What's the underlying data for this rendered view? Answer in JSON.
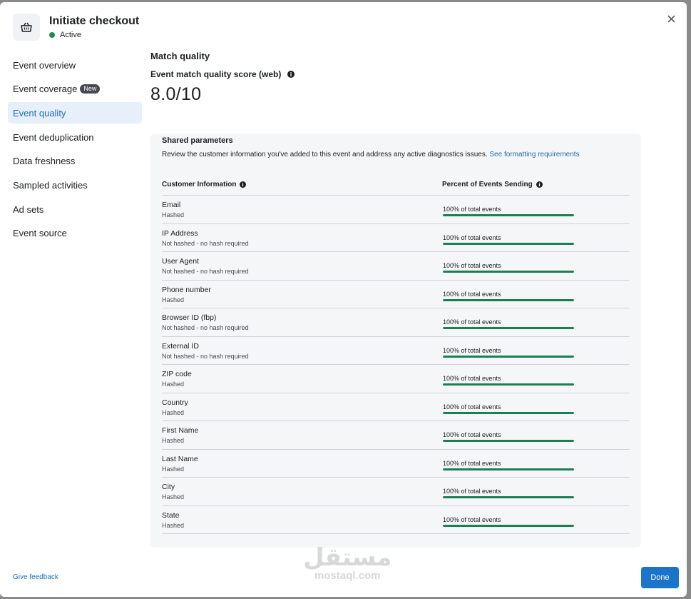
{
  "header": {
    "title": "Initiate checkout",
    "status": "Active",
    "status_color": "#1e8a4c"
  },
  "nav": {
    "items": [
      {
        "label": "Event overview"
      },
      {
        "label": "Event coverage",
        "badge": "New"
      },
      {
        "label": "Event quality"
      },
      {
        "label": "Event deduplication"
      },
      {
        "label": "Data freshness"
      },
      {
        "label": "Sampled activities"
      },
      {
        "label": "Ad sets"
      },
      {
        "label": "Event source"
      }
    ],
    "active_index": 2
  },
  "main": {
    "section_title": "Match quality",
    "score_label": "Event match quality score (web)",
    "score": "8.0/10"
  },
  "panel": {
    "title": "Shared parameters",
    "description": "Review the customer information you've added to this event and address any active diagnostics issues.",
    "link_text": "See formatting requirements",
    "col_left": "Customer Information",
    "col_right": "Percent of Events Sending",
    "rows": [
      {
        "name": "Email",
        "sub": "Hashed",
        "pct_text": "100% of total events",
        "pct": 100
      },
      {
        "name": "IP Address",
        "sub": "Not hashed - no hash required",
        "pct_text": "100% of total events",
        "pct": 100
      },
      {
        "name": "User Agent",
        "sub": "Not hashed - no hash required",
        "pct_text": "100% of total events",
        "pct": 100
      },
      {
        "name": "Phone number",
        "sub": "Hashed",
        "pct_text": "100% of total events",
        "pct": 100
      },
      {
        "name": "Browser ID (fbp)",
        "sub": "Not hashed - no hash required",
        "pct_text": "100% of total events",
        "pct": 100
      },
      {
        "name": "External ID",
        "sub": "Not hashed - no hash required",
        "pct_text": "100% of total events",
        "pct": 100
      },
      {
        "name": "ZIP code",
        "sub": "Hashed",
        "pct_text": "100% of total events",
        "pct": 100
      },
      {
        "name": "Country",
        "sub": "Hashed",
        "pct_text": "100% of total events",
        "pct": 100
      },
      {
        "name": "First Name",
        "sub": "Hashed",
        "pct_text": "100% of total events",
        "pct": 100
      },
      {
        "name": "Last Name",
        "sub": "Hashed",
        "pct_text": "100% of total events",
        "pct": 100
      },
      {
        "name": "City",
        "sub": "Hashed",
        "pct_text": "100% of total events",
        "pct": 100
      },
      {
        "name": "State",
        "sub": "Hashed",
        "pct_text": "100% of total events",
        "pct": 100
      }
    ]
  },
  "footer": {
    "feedback": "Give feedback",
    "done": "Done"
  },
  "watermark": {
    "arabic": "مستقل",
    "latin": "mostaql.com"
  },
  "colors": {
    "accent": "#1b74c9",
    "progress": "#1a7f52",
    "nav_active_bg": "#e7f0fa"
  }
}
